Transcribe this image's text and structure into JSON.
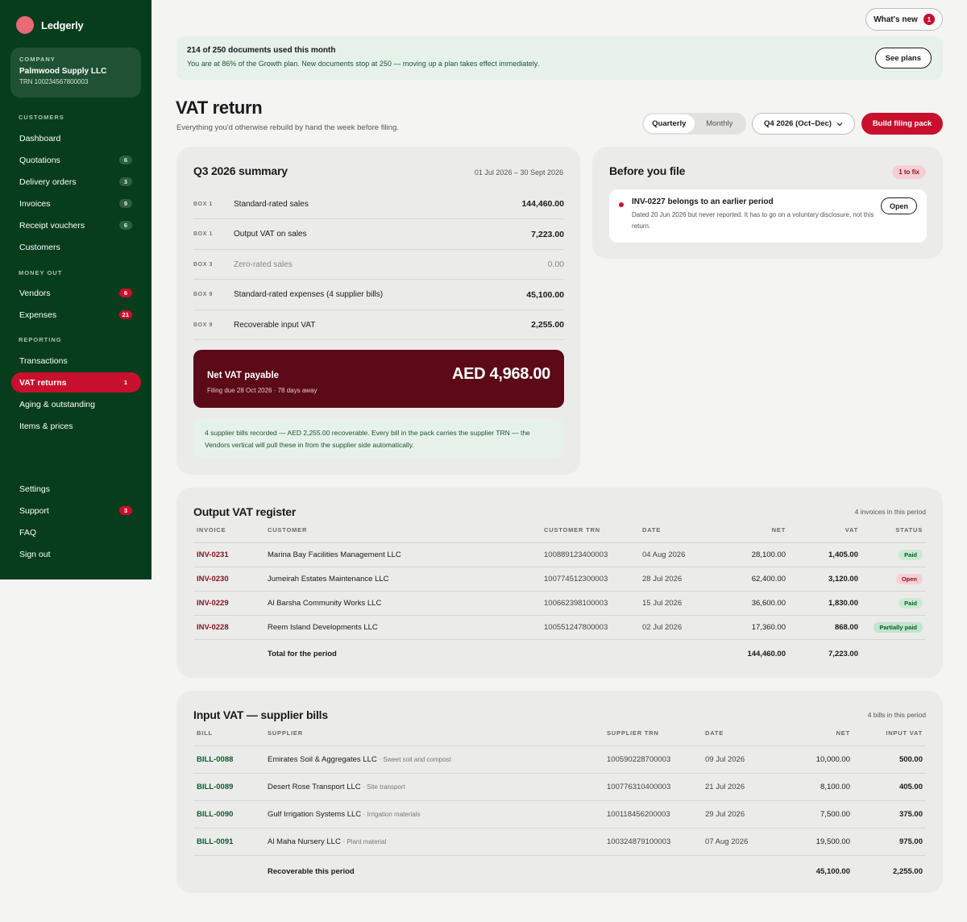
{
  "app": {
    "name": "Ledgerly"
  },
  "company": {
    "label": "COMPANY",
    "name": "Palmwood Supply LLC",
    "trn": "TRN 100234567800003"
  },
  "nav": {
    "customers_label": "CUSTOMERS",
    "customers": [
      {
        "label": "Dashboard",
        "count": ""
      },
      {
        "label": "Quotations",
        "count": "6"
      },
      {
        "label": "Delivery orders",
        "count": "3"
      },
      {
        "label": "Invoices",
        "count": "9"
      },
      {
        "label": "Receipt vouchers",
        "count": "6"
      },
      {
        "label": "Customers",
        "count": ""
      }
    ],
    "money_out_label": "MONEY OUT",
    "money_out": [
      {
        "label": "Vendors",
        "count": "6"
      },
      {
        "label": "Expenses",
        "count": "21"
      }
    ],
    "reporting_label": "REPORTING",
    "reporting": [
      {
        "label": "Transactions",
        "count": ""
      },
      {
        "label": "VAT returns",
        "count": "1"
      },
      {
        "label": "Aging & outstanding",
        "count": ""
      },
      {
        "label": "Items & prices",
        "count": ""
      }
    ],
    "bottom": [
      {
        "label": "Settings",
        "count": ""
      },
      {
        "label": "Support",
        "count": "3"
      },
      {
        "label": "FAQ",
        "count": ""
      },
      {
        "label": "Sign out",
        "count": ""
      }
    ]
  },
  "header": {
    "whats_new": "What's new",
    "whats_new_count": "1"
  },
  "banner": {
    "title": "214 of 250 documents used this month",
    "text": "You are at 86% of the Growth plan. New documents stop at 250 — moving up a plan takes effect immediately.",
    "button": "See plans",
    "used": 214,
    "limit": 250
  },
  "page": {
    "title": "VAT return",
    "subtitle": "Everything you'd otherwise rebuild by hand the week before filing.",
    "seg_quarterly": "Quarterly",
    "seg_monthly": "Monthly",
    "period": "Q4 2026 (Oct–Dec)",
    "build": "Build filing pack"
  },
  "summary": {
    "title": "Q3 2026 summary",
    "dates": "01 Jul 2026 – 30 Sept 2026",
    "rows": [
      {
        "box": "BOX 1",
        "label": "Standard-rated sales",
        "value": "144,460.00"
      },
      {
        "box": "BOX 1",
        "label": "Output VAT on sales",
        "value": "7,223.00"
      },
      {
        "box": "BOX 3",
        "label": "Zero-rated sales",
        "value": "0.00"
      },
      {
        "box": "BOX 9",
        "label": "Standard-rated expenses (4 supplier bills)",
        "value": "45,100.00"
      },
      {
        "box": "BOX 9",
        "label": "Recoverable input VAT",
        "value": "2,255.00"
      }
    ],
    "net_label": "Net VAT payable",
    "net_due": "Filing due 28 Oct 2026 · 78 days away",
    "net_amount": "AED 4,968.00",
    "note": "4 supplier bills recorded — AED 2,255.00 recoverable. Every bill in the pack carries the supplier TRN — the Vendors vertical will pull these in from the supplier side automatically."
  },
  "before_file": {
    "title": "Before you file",
    "badge": "1 to fix",
    "issue_title": "INV-0227 belongs to an earlier period",
    "issue_desc": "Dated 20 Jun 2026 but never reported. It has to go on a voluntary disclosure, not this return.",
    "open": "Open"
  },
  "output_vat": {
    "title": "Output VAT register",
    "count": "4 invoices in this period",
    "headers": [
      "INVOICE",
      "CUSTOMER",
      "CUSTOMER TRN",
      "DATE",
      "NET",
      "VAT",
      "STATUS"
    ],
    "rows": [
      {
        "invoice": "INV-0231",
        "customer": "Marina Bay Facilities Management LLC",
        "trn": "100889123400003",
        "date": "04 Aug 2026",
        "net": "28,100.00",
        "vat": "1,405.00",
        "status": "Paid"
      },
      {
        "invoice": "INV-0230",
        "customer": "Jumeirah Estates Maintenance LLC",
        "trn": "100774512300003",
        "date": "28 Jul 2026",
        "net": "62,400.00",
        "vat": "3,120.00",
        "status": "Open"
      },
      {
        "invoice": "INV-0229",
        "customer": "Al Barsha Community Works LLC",
        "trn": "100662398100003",
        "date": "15 Jul 2026",
        "net": "36,600.00",
        "vat": "1,830.00",
        "status": "Paid"
      },
      {
        "invoice": "INV-0228",
        "customer": "Reem Island Developments LLC",
        "trn": "100551247800003",
        "date": "02 Jul 2026",
        "net": "17,360.00",
        "vat": "868.00",
        "status": "Partially paid"
      }
    ],
    "total_label": "Total for the period",
    "total_net": "144,460.00",
    "total_vat": "7,223.00"
  },
  "input_vat": {
    "title": "Input VAT — supplier bills",
    "count": "4 bills in this period",
    "headers": [
      "BILL",
      "SUPPLIER",
      "SUPPLIER TRN",
      "DATE",
      "NET",
      "INPUT VAT"
    ],
    "rows": [
      {
        "bill": "BILL-0088",
        "supplier": "Emirates Soil & Aggregates LLC",
        "desc": "· Sweet soil and compost",
        "trn": "100590228700003",
        "date": "09 Jul 2026",
        "net": "10,000.00",
        "vat": "500.00"
      },
      {
        "bill": "BILL-0089",
        "supplier": "Desert Rose Transport LLC",
        "desc": "· Site transport",
        "trn": "100776310400003",
        "date": "21 Jul 2026",
        "net": "8,100.00",
        "vat": "405.00"
      },
      {
        "bill": "BILL-0090",
        "supplier": "Gulf Irrigation Systems LLC",
        "desc": "· Irrigation materials",
        "trn": "100118456200003",
        "date": "29 Jul 2026",
        "net": "7,500.00",
        "vat": "375.00"
      },
      {
        "bill": "BILL-0091",
        "supplier": "Al Maha Nursery LLC",
        "desc": "· Plant material",
        "trn": "100324879100003",
        "date": "07 Aug 2026",
        "net": "19,500.00",
        "vat": "975.00"
      }
    ],
    "total_label": "Recoverable this period",
    "total_net": "45,100.00",
    "total_vat": "2,255.00"
  },
  "colors": {
    "sidebar": "#073d1c",
    "accent": "#c8102e",
    "net_box": "#5c0a17",
    "banner": "#e6f2e9"
  }
}
